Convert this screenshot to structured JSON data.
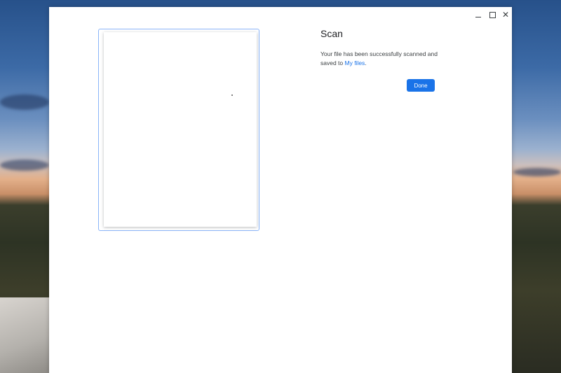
{
  "window": {
    "controls": {
      "minimize_icon": "minimize-icon",
      "maximize_icon": "maximize-icon",
      "close_icon": "close-icon",
      "close_glyph": "✕"
    }
  },
  "scan": {
    "title": "Scan",
    "message_prefix": "Your file has been successfully scanned and saved to ",
    "link_text": "My files",
    "message_suffix": ".",
    "done_label": "Done"
  },
  "colors": {
    "accent": "#1a73e8",
    "preview_border": "#8ab4f8"
  }
}
